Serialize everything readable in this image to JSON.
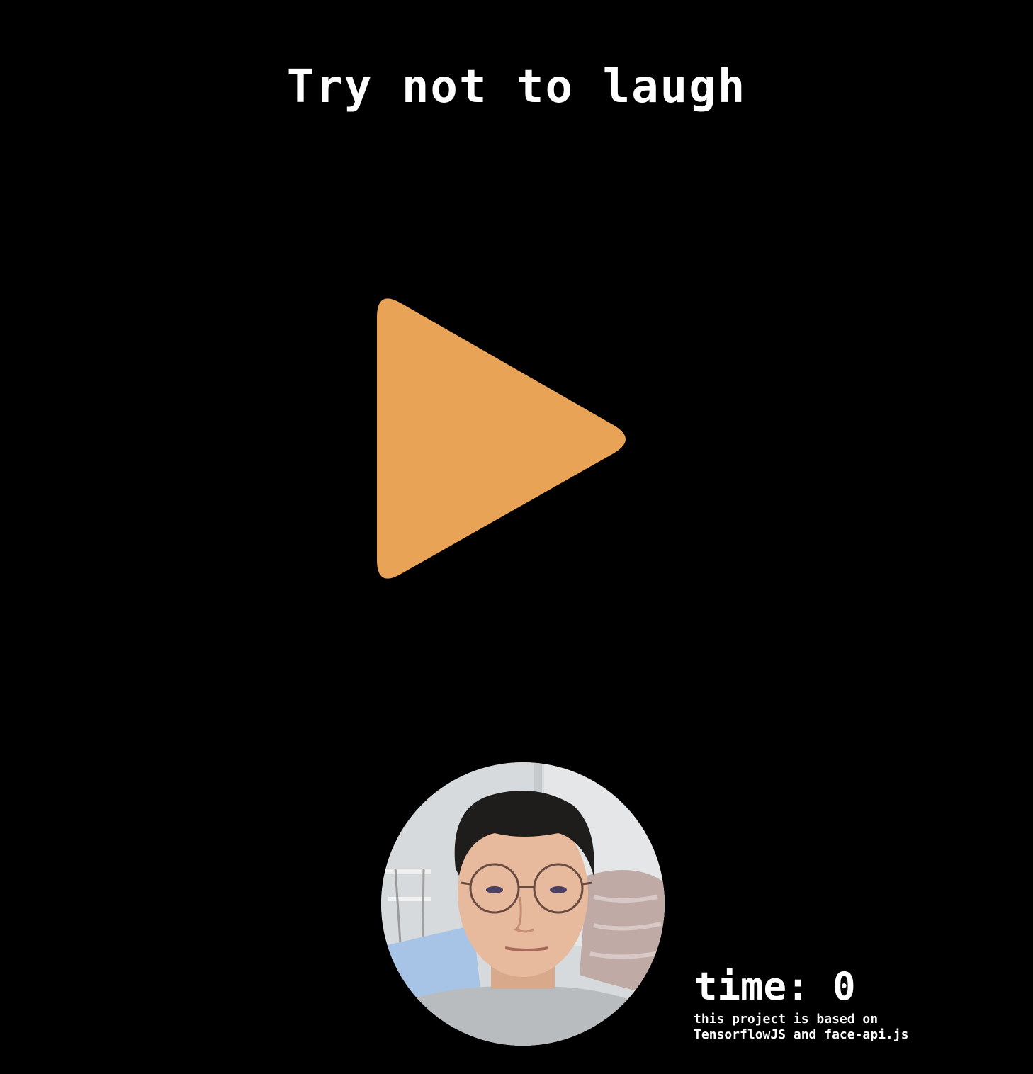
{
  "title": "Try not to laugh",
  "play_button": {
    "icon": "play-icon",
    "color": "#E8A356"
  },
  "webcam": {
    "description_icon": "webcam-feed"
  },
  "timer": {
    "label": "time: 0"
  },
  "credit": {
    "line1": "this project is based on",
    "line2": "TensorflowJS and face-api.js"
  },
  "colors": {
    "background": "#000000",
    "text": "#FFFFFF",
    "accent": "#E8A356"
  }
}
